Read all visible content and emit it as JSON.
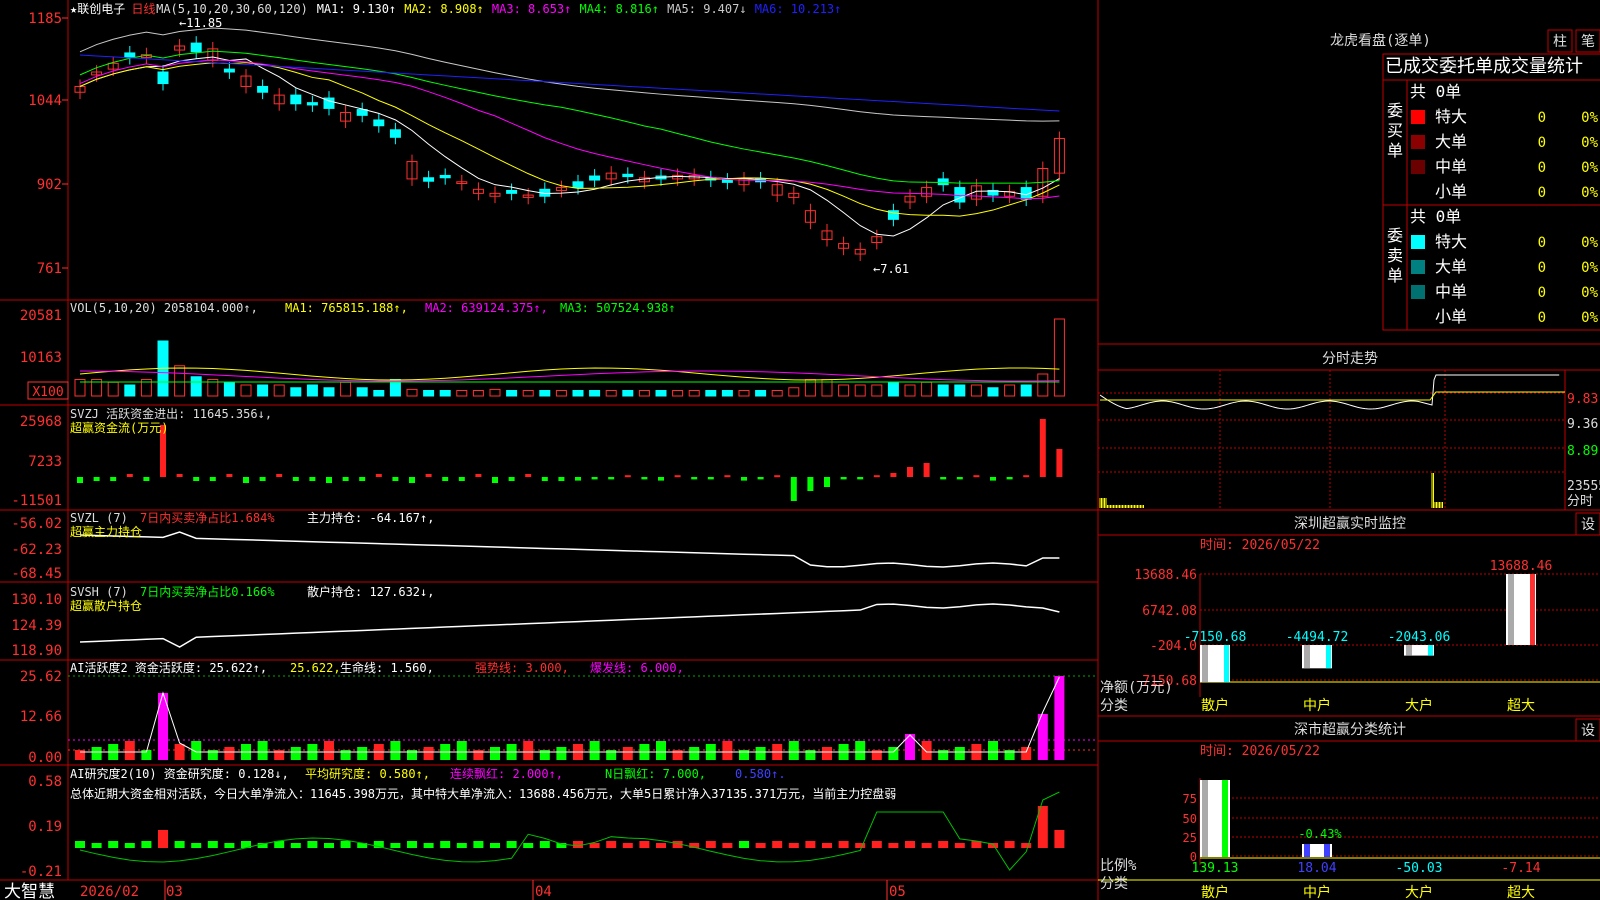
{
  "stock": {
    "title": "★联创电子",
    "period": "日线",
    "ma_params": "MA(5,10,20,30,60,120)",
    "ma_values": [
      {
        "name": "MA1",
        "value": "9.130",
        "arrow": "↑",
        "color": "#ffffff"
      },
      {
        "name": "MA2",
        "value": "8.908",
        "arrow": "↑",
        "color": "#ffff00"
      },
      {
        "name": "MA3",
        "value": "8.653",
        "arrow": "↑",
        "color": "#ff00ff"
      },
      {
        "name": "MA4",
        "value": "8.816",
        "arrow": "↑",
        "color": "#00ff00"
      },
      {
        "name": "MA5",
        "value": "9.407",
        "arrow": "↓",
        "color": "#c8c8c8"
      },
      {
        "name": "MA6",
        "value": "10.213",
        "arrow": "↑",
        "color": "#2020ff"
      }
    ],
    "price_axis": [
      "1185",
      "1044",
      "902",
      "761"
    ],
    "high_marker": "11.85",
    "low_marker": "7.61",
    "ma_colors": {
      "ma5": "#ffffff",
      "ma10": "#ffff00",
      "ma20": "#ff00ff",
      "ma30": "#00ff00",
      "ma60": "#c8c8c8",
      "ma120": "#2020ff"
    },
    "up_color": "#ff3030",
    "down_color": "#00ffff"
  },
  "indicators": {
    "vol": {
      "text": "VOL(5,10,20)",
      "value": "2058104.000",
      "ma1": "765815.188",
      "ma2": "639124.375",
      "ma3": "507524.938",
      "axis": [
        "20581",
        "10163"
      ],
      "unit": "X100"
    },
    "svzj": {
      "name": "SVZJ",
      "label": "活跃资金进出:",
      "value": "11645.356",
      "arrow": "↓",
      "sub": "超赢资金流(万元)",
      "axis": [
        "25968",
        "7233",
        "-11501"
      ]
    },
    "svzl": {
      "name": "SVZL (7)",
      "label": "7日内买卖净占比1.684%",
      "label2": "主力持仓:",
      "value": "-64.167",
      "sub": "超赢主力持仓",
      "axis": [
        "-56.02",
        "-62.23",
        "-68.45"
      ]
    },
    "svsh": {
      "name": "SVSH (7)",
      "label": "7日内买卖净占比0.166%",
      "label2": "散户持仓:",
      "value": "127.632",
      "sub": "超赢散户持仓",
      "axis": [
        "130.10",
        "124.39",
        "118.90"
      ]
    },
    "ai_active": {
      "name": "AI活跃度2",
      "l1": "资金活跃度:",
      "v1": "25.622",
      "v1b": "25.622",
      "l2": "生命线:",
      "v2": "1.560",
      "l3": "强势线:",
      "v3": "3.000",
      "l4": "爆发线:",
      "v4": "6.000",
      "axis": [
        "25.62",
        "12.66",
        "0.00"
      ]
    },
    "ai_research": {
      "name": "AI研究度2(10)",
      "l1": "资金研究度:",
      "v1": "0.128",
      "l2": "平均研究度:",
      "v2": "0.580",
      "l3": "连续飘红:",
      "v3": "2.000",
      "l4": "N日飘红:",
      "v4": "7.000",
      "v5": "0.580",
      "summary": "总体近期大资金相对活跃，今日大单净流入：11645.398万元，其中特大单净流入：13688.456万元，大单5日累计净入37135.371万元，当前主力控盘弱",
      "axis": [
        "0.58",
        "0.19",
        "-0.21"
      ]
    }
  },
  "date_axis": {
    "year": "2026/02",
    "months": [
      "03",
      "04",
      "05"
    ]
  },
  "app_name": "大智慧",
  "right_panel": {
    "dragon": {
      "title": "龙虎看盘(逐单)",
      "btn1": "柱",
      "btn2": "笔",
      "header": "已成交委托单成交量统计",
      "buy": {
        "label": "委买单",
        "total": "共 0单",
        "rows": [
          {
            "name": "特大",
            "count": "0",
            "pct": "0%",
            "color": "#ff0000"
          },
          {
            "name": "大单",
            "count": "0",
            "pct": "0%",
            "color": "#8b0000"
          },
          {
            "name": "中单",
            "count": "0",
            "pct": "0%",
            "color": "#6a0000"
          },
          {
            "name": "小单",
            "count": "0",
            "pct": "0%",
            "color": "#000000"
          }
        ]
      },
      "sell": {
        "label": "委卖单",
        "total": "共 0单",
        "rows": [
          {
            "name": "特大",
            "count": "0",
            "pct": "0%",
            "color": "#00ffff"
          },
          {
            "name": "大单",
            "count": "0",
            "pct": "0%",
            "color": "#008080"
          },
          {
            "name": "中单",
            "count": "0",
            "pct": "0%",
            "color": "#007070"
          },
          {
            "name": "小单",
            "count": "0",
            "pct": "0%",
            "color": "#000000"
          }
        ]
      }
    },
    "intraday": {
      "title": "分时走势",
      "axis": [
        "9.83",
        "9.36",
        "8.89",
        "23555"
      ],
      "label": "分时"
    },
    "sz_monitor": {
      "title": "深圳超赢实时监控",
      "btn": "设",
      "time": "时间: 2026/05/22",
      "axis": [
        "13688.46",
        "6742.08",
        "-204.0",
        "-7150.68"
      ],
      "ylabel": "净额(万元)",
      "xlabel": "分类",
      "bars": [
        {
          "cat": "散户",
          "value": -7150.68,
          "label": "-7150.68"
        },
        {
          "cat": "中户",
          "value": -4494.72,
          "label": "-4494.72"
        },
        {
          "cat": "大户",
          "value": -2043.06,
          "label": "-2043.06"
        },
        {
          "cat": "超大",
          "value": 13688.46,
          "label": "13688.46"
        }
      ]
    },
    "sz_stats": {
      "title": "深市超赢分类统计",
      "btn": "设",
      "time": "时间: 2026/05/22",
      "axis": [
        "75",
        "50",
        "25",
        "0"
      ],
      "ylabel": "比例%",
      "xlabel": "分类",
      "mid_label": "-0.43%",
      "cats": [
        {
          "cat": "散户",
          "value": "139.13",
          "color": "#00ff00"
        },
        {
          "cat": "中户",
          "value": "18.04",
          "color": "#4040ff"
        },
        {
          "cat": "大户",
          "value": "-50.03",
          "color": "#00ffff"
        },
        {
          "cat": "超大",
          "value": "-7.14",
          "color": "#ff3030"
        }
      ]
    }
  }
}
